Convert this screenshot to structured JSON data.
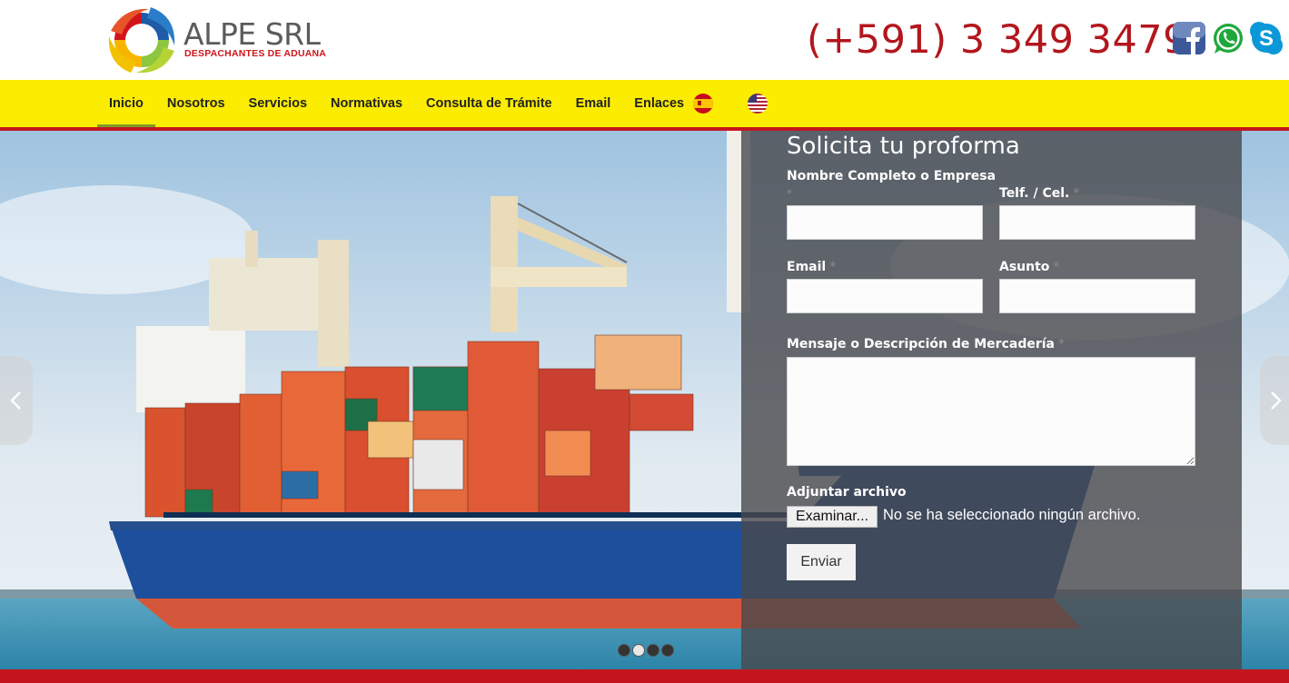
{
  "brand": {
    "name": "ALPE SRL",
    "tagline": "DESPACHANTES DE ADUANA",
    "colors": {
      "red": "#c4161c",
      "yellow": "#fcec00",
      "green": "#7d9a29"
    }
  },
  "header": {
    "phone": "(+591) 3 349 3479",
    "social_icons": [
      "facebook-icon",
      "whatsapp-icon",
      "skype-icon"
    ]
  },
  "nav": {
    "items": [
      {
        "label": "Inicio",
        "active": true
      },
      {
        "label": "Nosotros"
      },
      {
        "label": "Servicios"
      },
      {
        "label": "Normativas"
      },
      {
        "label": "Consulta de Trámite"
      },
      {
        "label": "Email"
      },
      {
        "label": "Enlaces"
      }
    ],
    "languages": [
      "spanish-flag-icon",
      "us-flag-icon"
    ]
  },
  "slider": {
    "prev_icon": "chevron-left-icon",
    "next_icon": "chevron-right-icon",
    "dots": 4,
    "active_dot": 2
  },
  "form": {
    "title": "Solicita tu proforma",
    "name_label": "Nombre Completo o Empresa",
    "phone_label": "Telf. / Cel.",
    "email_label": "Email",
    "subject_label": "Asunto",
    "message_label": "Mensaje o Descripción de Mercadería",
    "required_mark": "*",
    "attach_label": "Adjuntar archivo",
    "file_button": "Examinar...",
    "file_status": "No se ha seleccionado ningún archivo.",
    "submit": "Enviar"
  }
}
